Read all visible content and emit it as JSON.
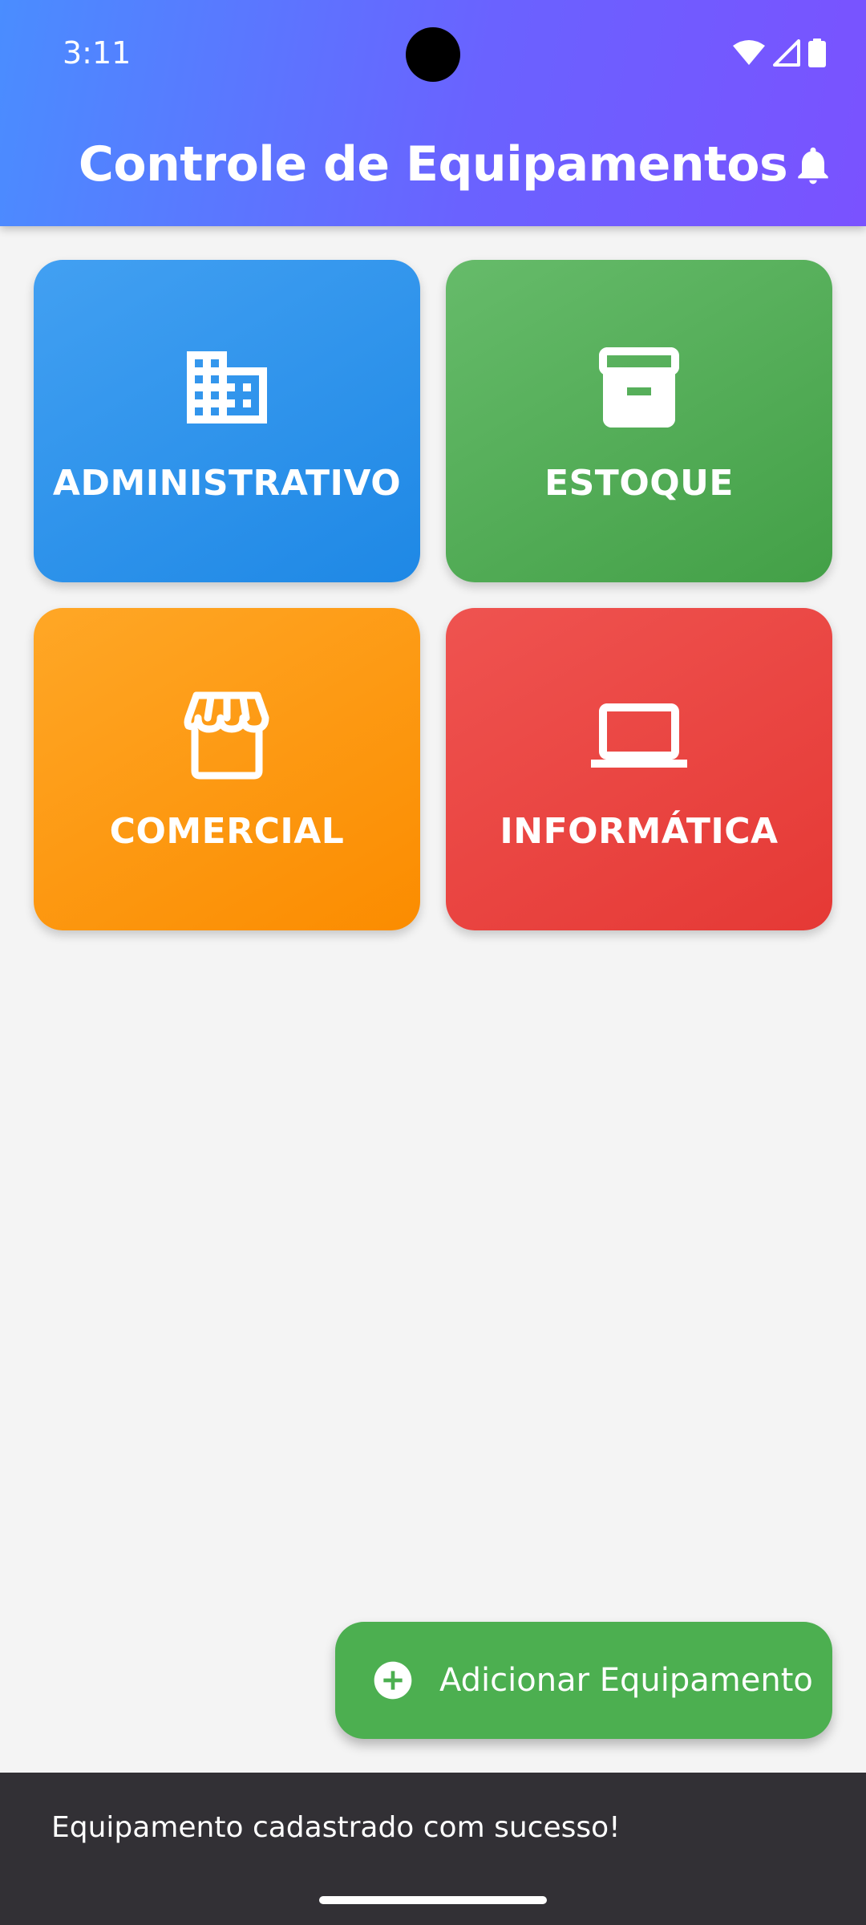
{
  "status_bar": {
    "time": "3:11",
    "icons": [
      "wifi-icon",
      "signal-icon",
      "battery-icon"
    ]
  },
  "app_bar": {
    "title": "Controle de Equipamentos",
    "action_icon": "bell-icon"
  },
  "categories": [
    {
      "label": "ADMINISTRATIVO",
      "icon": "building-icon",
      "color": "#1e88e5"
    },
    {
      "label": "ESTOQUE",
      "icon": "archive-icon",
      "color": "#43a047"
    },
    {
      "label": "COMERCIAL",
      "icon": "storefront-icon",
      "color": "#fb8c00"
    },
    {
      "label": "INFORMÁTICA",
      "icon": "laptop-icon",
      "color": "#e53935"
    }
  ],
  "fab": {
    "label": "Adicionar Equipamento",
    "icon": "add-circle-icon",
    "color": "#4caf50"
  },
  "snackbar": {
    "message": "Equipamento cadastrado com sucesso!"
  },
  "theme": {
    "header_start": "#4a8dff",
    "header_end": "#7a52ff",
    "background": "#f4f4f4"
  }
}
